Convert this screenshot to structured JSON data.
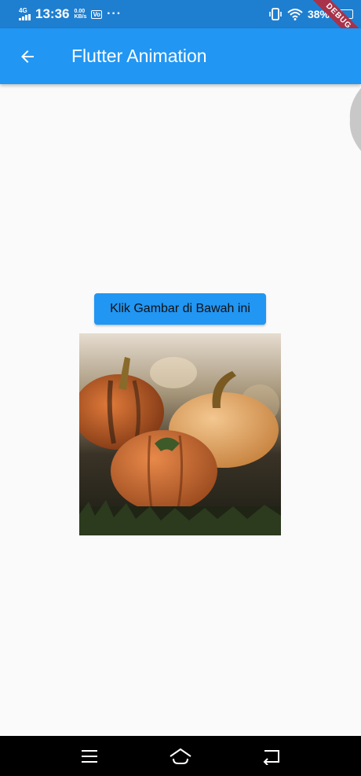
{
  "status_bar": {
    "network_type": "4G",
    "time": "13:36",
    "speed_value": "0.00",
    "speed_unit": "KB/s",
    "vo_label": "Vo",
    "more_indicator": "···",
    "battery_percent": "38%",
    "battery_level": 0.38
  },
  "debug_banner": "DEBUG",
  "app_bar": {
    "title": "Flutter Animation"
  },
  "main": {
    "button_label": "Klik Gambar di Bawah ini"
  },
  "colors": {
    "app_bar": "#2196f3",
    "status_bar": "#1e7fd1",
    "background": "#fafafa",
    "debug_banner": "#a8324a",
    "nav_bar": "#000000"
  },
  "icons": {
    "back": "arrow-left-icon",
    "nav_menu": "menu-icon",
    "nav_home": "home-icon",
    "nav_back": "return-icon"
  }
}
